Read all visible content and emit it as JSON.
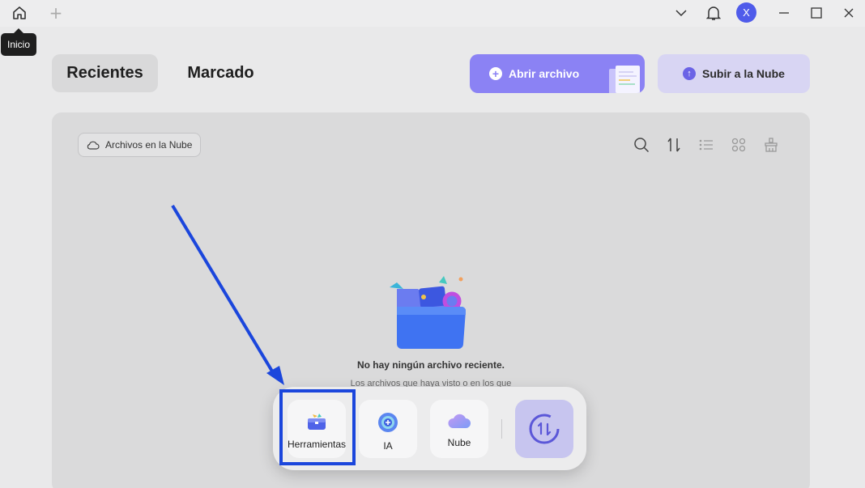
{
  "titlebar": {
    "home_tooltip": "Inicio",
    "avatar_letter": "X"
  },
  "tabs": [
    {
      "label": "Recientes",
      "active": true
    },
    {
      "label": "Marcado",
      "active": false
    }
  ],
  "actions": {
    "open_file": "Abrir archivo",
    "upload_cloud": "Subir a la Nube"
  },
  "panel": {
    "cloud_chip": "Archivos en la Nube",
    "empty_title": "No hay ningún archivo reciente.",
    "empty_subtitle": "Los archivos que haya visto o en los que"
  },
  "dock": {
    "items": [
      {
        "label": "Herramientas",
        "icon": "toolbox-icon"
      },
      {
        "label": "IA",
        "icon": "ai-icon"
      },
      {
        "label": "Nube",
        "icon": "cloud-icon"
      }
    ],
    "sync_icon": "sync-icon"
  },
  "colors": {
    "accent": "#8b82f4",
    "accent_light": "#d8d5f3",
    "highlight": "#1b46dc",
    "avatar": "#4f5bea"
  }
}
